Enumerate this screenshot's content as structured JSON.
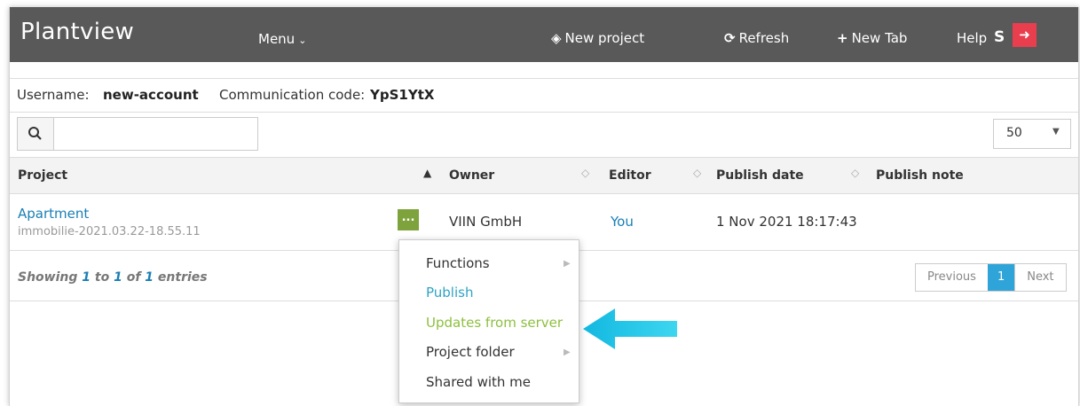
{
  "navbar": {
    "brand": "Plantview",
    "menu_label": "Menu",
    "new_project": "New project",
    "refresh": "Refresh",
    "new_tab": "New Tab",
    "help": "Help",
    "user_initial": "S"
  },
  "info": {
    "username_label": "Username:",
    "username": "new-account",
    "code_label": "Communication code:",
    "code": "YpS1YtX"
  },
  "search": {
    "value": "",
    "placeholder": ""
  },
  "page_size": "50",
  "table": {
    "columns": [
      "Project",
      "Owner",
      "Editor",
      "Publish date",
      "Publish note"
    ],
    "rows": [
      {
        "project": "Apartment",
        "project_id": "immobilie-2021.03.22-18.55.11",
        "actions": "...",
        "owner": "VIIN GmbH",
        "editor": "You",
        "publish_date": "1 Nov 2021 18:17:43",
        "publish_note": ""
      }
    ]
  },
  "footer": {
    "showing_prefix": "Showing ",
    "from": "1",
    "to_word": " to ",
    "to": "1",
    "of_word": " of ",
    "total": "1",
    "suffix": " entries"
  },
  "pagination": {
    "previous": "Previous",
    "current": "1",
    "next": "Next"
  },
  "context_menu": {
    "items": [
      "Functions",
      "Publish",
      "Updates from server",
      "Project folder",
      "Shared with me"
    ]
  },
  "colors": {
    "navbar": "#595959",
    "link": "#1a7fb5",
    "publish": "#2fa4c4",
    "updates": "#8dbf3f",
    "action_button": "#7ea33c",
    "logout": "#e83e4e",
    "pointer_arrow": "#1ec8ea"
  }
}
